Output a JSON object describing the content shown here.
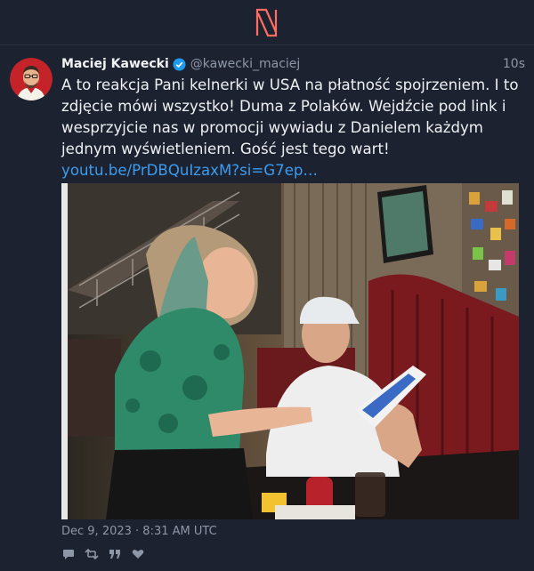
{
  "app": {
    "logo_icon": "nitter-n-logo",
    "accent": "#ff6c60"
  },
  "tweet": {
    "author_name": "Maciej Kawecki",
    "handle": "@kawecki_maciej",
    "timestamp": "10s",
    "verified": true,
    "text": "A to reakcja Pani kelnerki w USA na płatność spojrzeniem. I to zdjęcie mówi wszystko! Duma z Polaków. Wejdźcie pod link i wesprzyjcie nas w promocji wywiadu z Danielem każdym jednym wyświetleniem. Gość jest tego wart!",
    "link": "youtu.be/PrDBQuIzaxM?si=G7ep…",
    "date": "Dec 9, 2023 · 8:31 AM UTC"
  },
  "actions": [
    "comment-icon",
    "retweet-icon",
    "quote-icon",
    "heart-icon"
  ]
}
